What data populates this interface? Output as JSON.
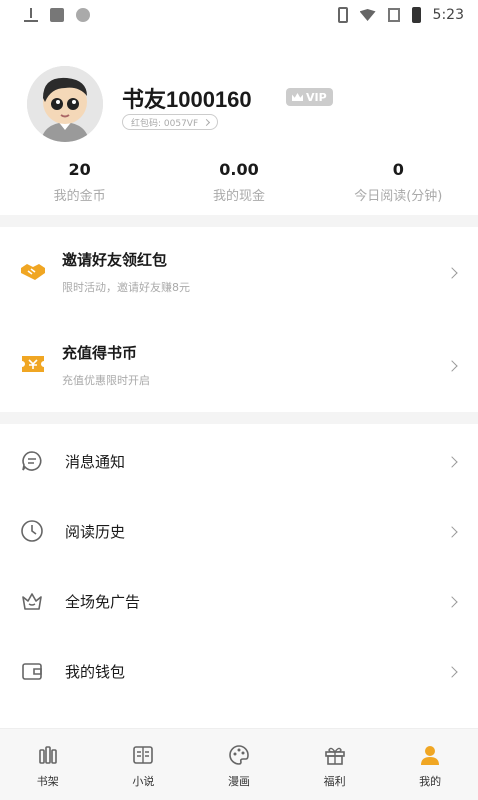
{
  "status_bar": {
    "time": "5:23"
  },
  "profile": {
    "username": "书友1000160",
    "vip_label": "VIP",
    "invite_code": "红包码: 0057VF"
  },
  "stats": [
    {
      "value": "20",
      "label": "我的金币"
    },
    {
      "value": "0.00",
      "label": "我的现金"
    },
    {
      "value": "0",
      "label": "今日阅读(分钟)"
    }
  ],
  "promos": [
    {
      "title": "邀请好友领红包",
      "subtitle": "限时活动，邀请好友赚8元",
      "icon": "handshake-icon"
    },
    {
      "title": "充值得书币",
      "subtitle": "充值优惠限时开启",
      "icon": "ticket-icon"
    }
  ],
  "menu": [
    {
      "label": "消息通知",
      "icon": "message-icon"
    },
    {
      "label": "阅读历史",
      "icon": "clock-icon"
    },
    {
      "label": "全场免广告",
      "icon": "crown-basket-icon"
    },
    {
      "label": "我的钱包",
      "icon": "wallet-icon"
    }
  ],
  "tabs": [
    {
      "label": "书架",
      "icon": "bookshelf-icon"
    },
    {
      "label": "小说",
      "icon": "book-icon"
    },
    {
      "label": "漫画",
      "icon": "palette-icon"
    },
    {
      "label": "福利",
      "icon": "gift-icon"
    },
    {
      "label": "我的",
      "icon": "user-icon",
      "active": true
    }
  ],
  "colors": {
    "accent": "#f0a623",
    "icon_gray": "#666666"
  }
}
